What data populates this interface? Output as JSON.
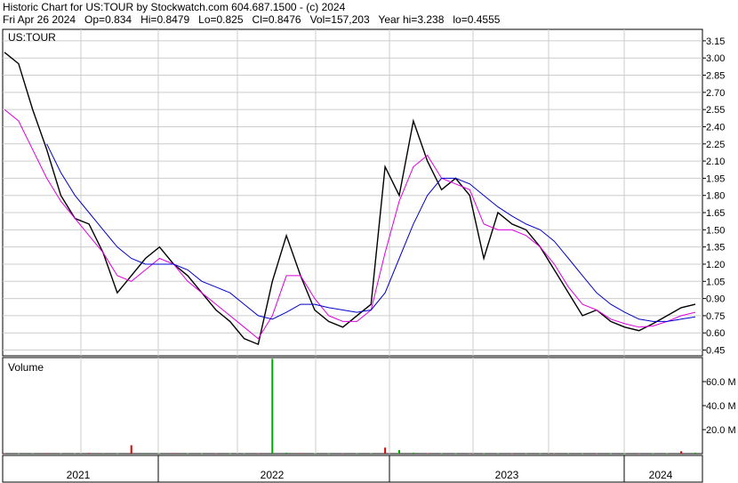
{
  "header": {
    "line1": "Historic Chart for US:TOUR by Stockwatch.com 604.687.1500 - (c) 2024",
    "line2": "Fri Apr 26 2024   Op=0.834   Hi=0.8479   Lo=0.825   Cl=0.8476   Vol=157,203   Year hi=3.238   lo=0.4555"
  },
  "colors": {
    "price": "#000000",
    "ma_short": "#e000e0",
    "ma_long": "#0000cc",
    "volume_up": "#00aa00",
    "volume_down": "#dd0000",
    "grid": "#cccccc"
  },
  "chart_data": [
    {
      "type": "line",
      "panel": "price",
      "label": "US:TOUR",
      "ylim": [
        0.4,
        3.25
      ],
      "y_ticks": [
        "3.15",
        "3.00",
        "2.85",
        "2.70",
        "2.55",
        "2.40",
        "2.25",
        "2.10",
        "1.95",
        "1.80",
        "1.65",
        "1.50",
        "1.35",
        "1.20",
        "1.05",
        "0.90",
        "0.75",
        "0.60",
        "0.45"
      ],
      "x_labels": [
        "2021",
        "2022",
        "2023",
        "2024"
      ],
      "grid": true,
      "x": [
        "2020-11",
        "2020-12",
        "2021-01",
        "2021-02",
        "2021-03",
        "2021-04",
        "2021-05",
        "2021-06",
        "2021-07",
        "2021-08",
        "2021-09",
        "2021-10",
        "2021-11",
        "2021-12",
        "2022-01",
        "2022-02",
        "2022-03",
        "2022-04",
        "2022-05",
        "2022-06",
        "2022-07",
        "2022-08",
        "2022-09",
        "2022-10",
        "2022-11",
        "2022-12",
        "2023-01",
        "2023-02",
        "2023-03",
        "2023-04",
        "2023-05",
        "2023-06",
        "2023-07",
        "2023-08",
        "2023-09",
        "2023-10",
        "2023-11",
        "2023-12",
        "2024-01",
        "2024-02",
        "2024-03",
        "2024-04"
      ],
      "series": [
        {
          "values": [
            3.05,
            2.95,
            2.55,
            2.2,
            1.8,
            1.6,
            1.55,
            1.3,
            0.95,
            1.1,
            1.25,
            1.35,
            1.2,
            1.1,
            0.95,
            0.8,
            0.7,
            0.55,
            0.5,
            1.05,
            1.45,
            1.1,
            0.8,
            0.7,
            0.65,
            0.75,
            0.85,
            2.05,
            1.8,
            2.45,
            2.1,
            1.85,
            1.95,
            1.8,
            1.25,
            1.65,
            1.55,
            1.5,
            1.35,
            1.15,
            0.95,
            0.75,
            0.8,
            0.7,
            0.65,
            0.62,
            0.68,
            0.75,
            0.82,
            0.85
          ]
        },
        {
          "values": [
            2.55,
            2.45,
            2.2,
            1.95,
            1.75,
            1.6,
            1.45,
            1.3,
            1.1,
            1.05,
            1.15,
            1.25,
            1.2,
            1.05,
            0.95,
            0.85,
            0.75,
            0.65,
            0.55,
            0.75,
            1.1,
            1.1,
            0.9,
            0.75,
            0.7,
            0.7,
            0.8,
            1.3,
            1.75,
            2.05,
            2.15,
            1.95,
            1.9,
            1.85,
            1.55,
            1.5,
            1.5,
            1.45,
            1.35,
            1.2,
            1.0,
            0.85,
            0.8,
            0.72,
            0.68,
            0.65,
            0.66,
            0.7,
            0.75,
            0.78
          ]
        },
        {
          "values": [
            null,
            null,
            null,
            2.25,
            2.0,
            1.8,
            1.65,
            1.5,
            1.35,
            1.25,
            1.2,
            1.2,
            1.2,
            1.15,
            1.05,
            1.0,
            0.95,
            0.85,
            0.75,
            0.72,
            0.78,
            0.85,
            0.85,
            0.82,
            0.8,
            0.78,
            0.8,
            0.95,
            1.25,
            1.55,
            1.8,
            1.95,
            1.95,
            1.9,
            1.8,
            1.7,
            1.62,
            1.55,
            1.5,
            1.4,
            1.25,
            1.1,
            0.95,
            0.85,
            0.78,
            0.72,
            0.7,
            0.7,
            0.72,
            0.74
          ]
        }
      ]
    },
    {
      "type": "bar",
      "panel": "volume",
      "label": "Volume",
      "ylim": [
        0,
        80
      ],
      "y_ticks": [
        "60.0 M",
        "40.0 M",
        "20.0 M"
      ],
      "values": [
        0.3,
        0.2,
        0.4,
        0.5,
        0.3,
        0.3,
        0.6,
        0.5,
        0.2,
        7.0,
        0.6,
        0.4,
        0.5,
        0.3,
        0.2,
        0.3,
        0.2,
        0.3,
        0.4,
        79.0,
        0.8,
        0.5,
        0.3,
        0.2,
        0.3,
        0.3,
        0.4,
        5.0,
        3.0,
        0.8,
        0.4,
        0.3,
        0.2,
        0.2,
        0.3,
        0.4,
        0.2,
        0.2,
        0.2,
        0.3,
        0.3,
        0.2,
        0.2,
        0.2,
        0.2,
        0.2,
        0.3,
        0.4,
        2.0,
        0.8
      ]
    }
  ]
}
